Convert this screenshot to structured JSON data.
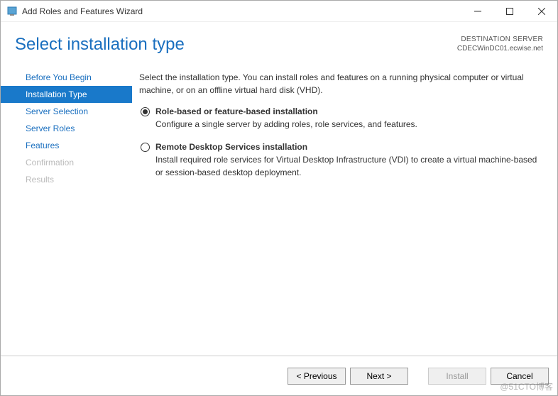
{
  "window": {
    "title": "Add Roles and Features Wizard"
  },
  "header": {
    "page_title": "Select installation type",
    "destination_label": "DESTINATION SERVER",
    "destination_server": "CDECWinDC01.ecwise.net"
  },
  "sidebar": {
    "items": [
      {
        "label": "Before You Begin",
        "state": "normal"
      },
      {
        "label": "Installation Type",
        "state": "selected"
      },
      {
        "label": "Server Selection",
        "state": "normal"
      },
      {
        "label": "Server Roles",
        "state": "normal"
      },
      {
        "label": "Features",
        "state": "normal"
      },
      {
        "label": "Confirmation",
        "state": "disabled"
      },
      {
        "label": "Results",
        "state": "disabled"
      }
    ]
  },
  "main": {
    "intro": "Select the installation type. You can install roles and features on a running physical computer or virtual machine, or on an offline virtual hard disk (VHD).",
    "options": [
      {
        "title": "Role-based or feature-based installation",
        "desc": "Configure a single server by adding roles, role services, and features.",
        "checked": true
      },
      {
        "title": "Remote Desktop Services installation",
        "desc": "Install required role services for Virtual Desktop Infrastructure (VDI) to create a virtual machine-based or session-based desktop deployment.",
        "checked": false
      }
    ]
  },
  "footer": {
    "previous": "< Previous",
    "next": "Next >",
    "install": "Install",
    "cancel": "Cancel"
  },
  "watermark": "@51CTO博客"
}
